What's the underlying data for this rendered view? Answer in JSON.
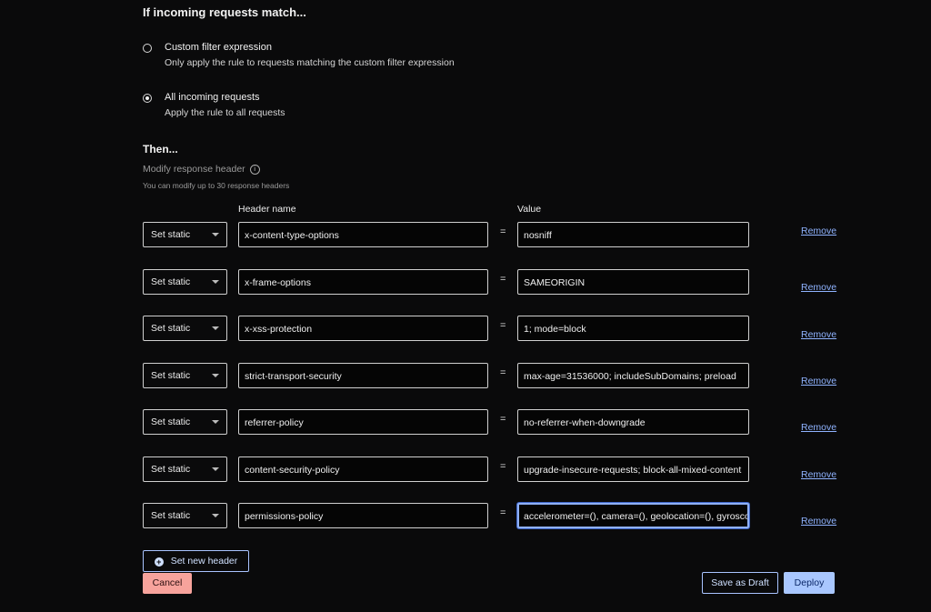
{
  "match_section": {
    "title": "If incoming requests match...",
    "options": [
      {
        "label": "Custom filter expression",
        "description": "Only apply the rule to requests matching the custom filter expression",
        "selected": false
      },
      {
        "label": "All incoming requests",
        "description": "Apply the rule to all requests",
        "selected": true
      }
    ]
  },
  "then_section": {
    "title": "Then...",
    "action_label": "Modify response header",
    "hint": "You can modify up to 30 response headers",
    "column_name": "Header name",
    "column_value": "Value",
    "equals": "=",
    "remove_label": "Remove",
    "rows": [
      {
        "operation": "Set static",
        "name": "x-content-type-options",
        "value": "nosniff"
      },
      {
        "operation": "Set static",
        "name": "x-frame-options",
        "value": "SAMEORIGIN"
      },
      {
        "operation": "Set static",
        "name": "x-xss-protection",
        "value": "1; mode=block"
      },
      {
        "operation": "Set static",
        "name": "strict-transport-security",
        "value": "max-age=31536000; includeSubDomains; preload"
      },
      {
        "operation": "Set static",
        "name": "referrer-policy",
        "value": "no-referrer-when-downgrade"
      },
      {
        "operation": "Set static",
        "name": "content-security-policy",
        "value": "upgrade-insecure-requests; block-all-mixed-content"
      },
      {
        "operation": "Set static",
        "name": "permissions-policy",
        "value": "accelerometer=(), camera=(), geolocation=(), gyrosco"
      }
    ],
    "set_new_header_label": "Set new header"
  },
  "footer": {
    "cancel_label": "Cancel",
    "save_draft_label": "Save as Draft",
    "deploy_label": "Deploy"
  },
  "colors": {
    "background": "#0a0a0b",
    "link": "#8fb3ff",
    "primary": "#a9c7ff",
    "danger": "#f7a39c",
    "focus": "#8fb0f5"
  }
}
